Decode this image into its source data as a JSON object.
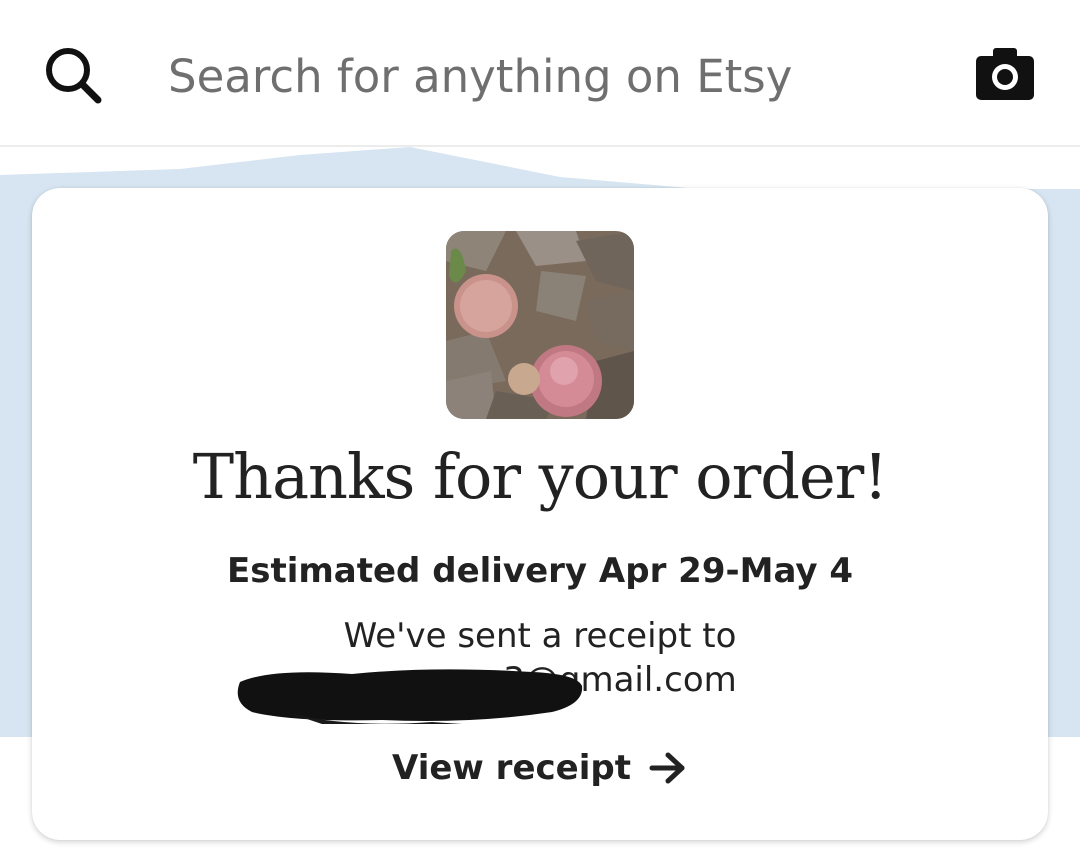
{
  "search": {
    "placeholder": "Search for anything on Etsy",
    "search_icon": "search-icon",
    "camera_icon": "camera-icon"
  },
  "order": {
    "title": "Thanks for your order!",
    "delivery": "Estimated delivery Apr 29-May 4",
    "receipt_sent": "We've sent a receipt to",
    "email_visible": "3@gmail.com",
    "view_receipt": "View receipt",
    "arrow_icon": "arrow-right-icon"
  },
  "colors": {
    "backdrop": "#d6e5f1",
    "text": "#222222",
    "placeholder": "#6f6f6f"
  }
}
